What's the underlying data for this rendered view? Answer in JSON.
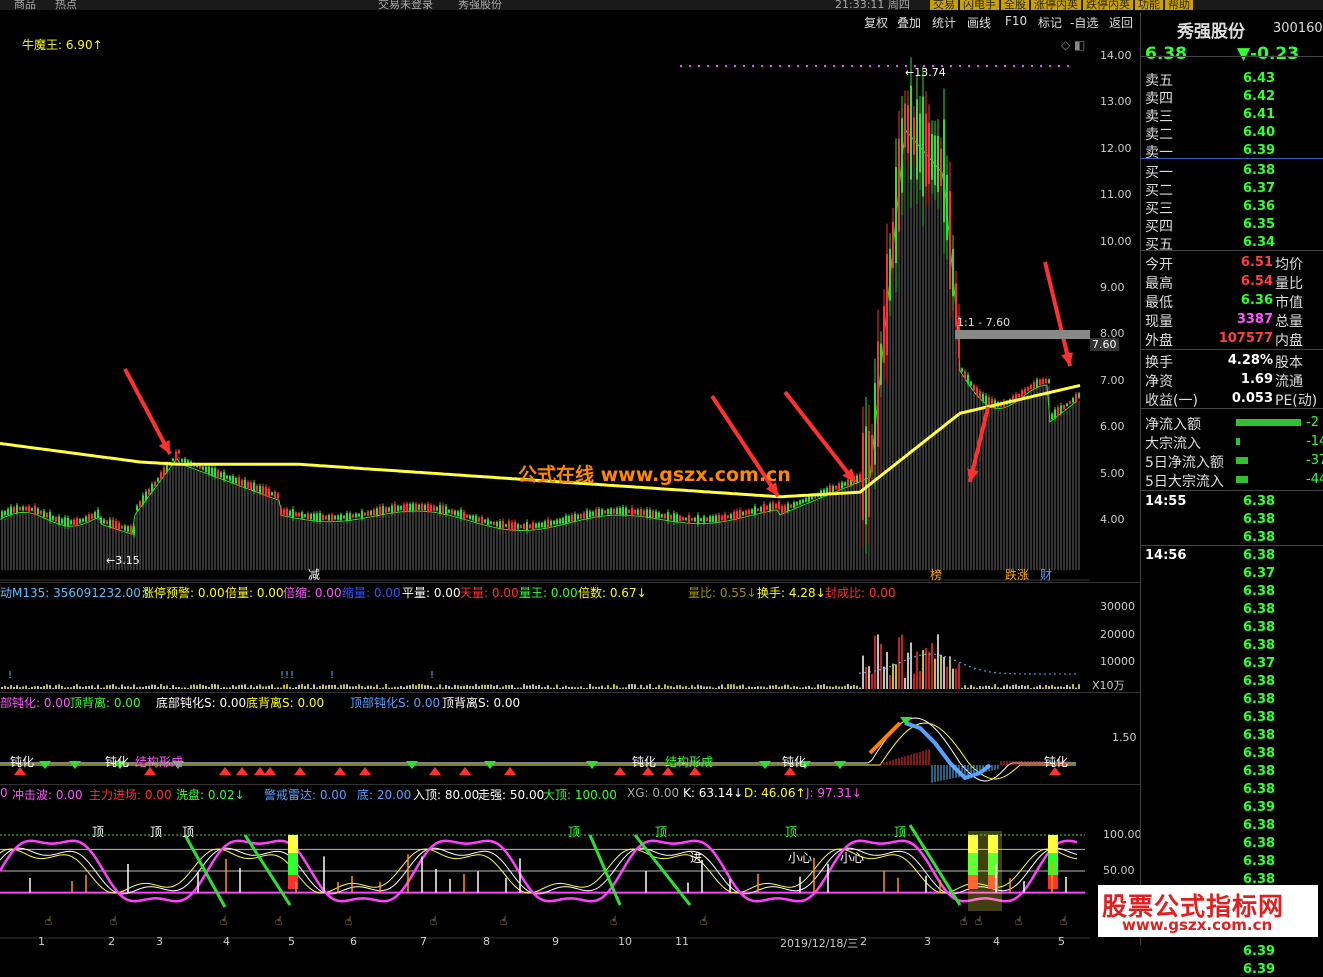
{
  "topbar": {
    "left1": "商品",
    "left2": "热点",
    "mid1": "交易未登录",
    "mid2": "秀强股份",
    "time": "21:33:11 周四",
    "buttons": [
      "交易",
      "闪电手",
      "全股",
      "涨停内英",
      "跌停内英",
      "功能",
      "帮助"
    ]
  },
  "toolbar": {
    "items": [
      "复权",
      "叠加",
      "统计",
      "画线",
      "F10",
      "标记",
      "-自选",
      "返回"
    ]
  },
  "main": {
    "indicator_name": "牛魔王: 6.90↑",
    "price_high_label": "←13.74",
    "price_low_label": "←3.15",
    "ref_line_label": "1:1 - 7.60",
    "ref_value": "7.60",
    "watermark": "公式在线  www.gszx.com.cn",
    "markers": [
      "减",
      "榜",
      "跌涨",
      "财"
    ],
    "y_ticks": [
      "14.00",
      "13.00",
      "12.00",
      "11.00",
      "10.00",
      "9.00",
      "8.00",
      "7.00",
      "6.00",
      "5.00",
      "4.00"
    ]
  },
  "pane2": {
    "labels": [
      {
        "t": "动M135: 356091232.00↑",
        "c": "#58c0ff"
      },
      {
        "t": "涨停预警: 0.00",
        "c": "#ffff00"
      },
      {
        "t": "倍量: 0.00",
        "c": "#ffff00"
      },
      {
        "t": "倍缩: 0.00",
        "c": "#ff55ff"
      },
      {
        "t": "缩量: 0.00",
        "c": "#3050ff"
      },
      {
        "t": "平量: 0.00",
        "c": "#ffffff"
      },
      {
        "t": "天量: 0.00",
        "c": "#ff3030"
      },
      {
        "t": "量王: 0.00",
        "c": "#30ff30"
      },
      {
        "t": "倍数: 0.67↓",
        "c": "#ffff00"
      },
      {
        "t": "量比: 0.55↓",
        "c": "#a09000"
      },
      {
        "t": "换手: 4.28↓",
        "c": "#ffff00"
      },
      {
        "t": "封成比: 0.00",
        "c": "#ff3030"
      }
    ],
    "y_ticks": [
      "30000",
      "20000",
      "10000",
      "X10万"
    ]
  },
  "pane3": {
    "labels": [
      {
        "t": "部钝化: 0.00",
        "c": "#ff55ff"
      },
      {
        "t": "顶背离: 0.00",
        "c": "#30ff30"
      },
      {
        "t": "底部钝化S: 0.00",
        "c": "#ffffff"
      },
      {
        "t": "底背离S: 0.00",
        "c": "#ffff00"
      },
      {
        "t": "顶部钝化S: 0.00",
        "c": "#58a0ff"
      },
      {
        "t": "顶背离S: 0.00",
        "c": "#ffffff"
      }
    ],
    "y_ticks": [
      "1.50"
    ],
    "tags": [
      "钝化",
      "钝化",
      "结构形成",
      "钝化",
      "结构形成",
      "钝化",
      "钝化"
    ]
  },
  "pane4": {
    "labels": [
      {
        "t": "0",
        "c": "#ff55ff"
      },
      {
        "t": "冲击波: 0.00",
        "c": "#ff55ff"
      },
      {
        "t": "主力进场: 0.00",
        "c": "#ff3030"
      },
      {
        "t": "洗盘: 0.02↓",
        "c": "#30ff30"
      },
      {
        "t": "警戒雷达: 0.00",
        "c": "#58a0ff"
      },
      {
        "t": "底: 20.00",
        "c": "#58a0ff"
      },
      {
        "t": "入顶: 80.00",
        "c": "#ffffff"
      },
      {
        "t": "走强: 50.00",
        "c": "#ffffff"
      },
      {
        "t": "大顶: 100.00",
        "c": "#30ff30"
      },
      {
        "t": "XG: 0.00",
        "c": "#aaaaaa"
      },
      {
        "t": "K: 63.14↓",
        "c": "#ffffff"
      },
      {
        "t": "D: 46.06↑",
        "c": "#ffff00"
      },
      {
        "t": "J: 97.31↓",
        "c": "#ff55ff"
      }
    ],
    "y_ticks": [
      "100.00",
      "50.00"
    ],
    "x_ticks": [
      "1",
      "2",
      "3",
      "4",
      "5",
      "6",
      "7",
      "8",
      "9",
      "10",
      "11",
      "2019/12/18/三",
      "2",
      "3",
      "4",
      "5"
    ],
    "tags": [
      "顶",
      "顶",
      "顶",
      "顶",
      "顶",
      "顶",
      "顶",
      "进",
      "小心",
      "小心"
    ]
  },
  "quote": {
    "name": "秀强股份",
    "code": "300160",
    "price": "6.38",
    "change": "▼-0.23",
    "asks": [
      {
        "l": "卖五",
        "v": "6.43"
      },
      {
        "l": "卖四",
        "v": "6.42"
      },
      {
        "l": "卖三",
        "v": "6.41"
      },
      {
        "l": "卖二",
        "v": "6.40"
      },
      {
        "l": "卖一",
        "v": "6.39"
      }
    ],
    "bids": [
      {
        "l": "买一",
        "v": "6.38"
      },
      {
        "l": "买二",
        "v": "6.37"
      },
      {
        "l": "买三",
        "v": "6.36"
      },
      {
        "l": "买四",
        "v": "6.35"
      },
      {
        "l": "买五",
        "v": "6.34"
      }
    ],
    "stats": [
      {
        "l": "今开",
        "v": "6.51",
        "r": "均价",
        "c": "#ff4040"
      },
      {
        "l": "最高",
        "v": "6.54",
        "r": "量比",
        "c": "#ff4040"
      },
      {
        "l": "最低",
        "v": "6.36",
        "r": "市值",
        "c": "#30ff30"
      },
      {
        "l": "现量",
        "v": "3387",
        "r": "总量",
        "c": "#ff55ff"
      },
      {
        "l": "外盘",
        "v": "107577",
        "r": "内盘",
        "c": "#ff4040"
      }
    ],
    "stats2": [
      {
        "l": "换手",
        "v": "4.28%",
        "r": "股本"
      },
      {
        "l": "净资",
        "v": "1.69",
        "r": "流通"
      },
      {
        "l": "收益(一)",
        "v": "0.053",
        "r": "PE(动)"
      }
    ],
    "flows": [
      {
        "l": "净流入额",
        "v": "-2"
      },
      {
        "l": "大宗流入",
        "v": "-14"
      },
      {
        "l": "5日净流入额",
        "v": "-37"
      },
      {
        "l": "5日大宗流入",
        "v": "-44"
      }
    ],
    "ticks": [
      {
        "t": "14:55",
        "v": [
          "6.38",
          "6.38",
          "6.38"
        ]
      },
      {
        "t": "14:56",
        "v": [
          "6.38",
          "6.37",
          "6.38",
          "6.38",
          "6.38",
          "6.38",
          "6.37",
          "6.38",
          "6.38",
          "6.38",
          "6.38",
          "6.38",
          "6.38",
          "6.38",
          "6.39",
          "6.38",
          "6.38",
          "6.38",
          "6.38",
          "6.39",
          "6.38",
          "6.38",
          "6.39",
          "6.39"
        ]
      }
    ]
  },
  "watermark2": {
    "text1": "股票公式指标网",
    "text2": "www.gszx.com.cn"
  }
}
